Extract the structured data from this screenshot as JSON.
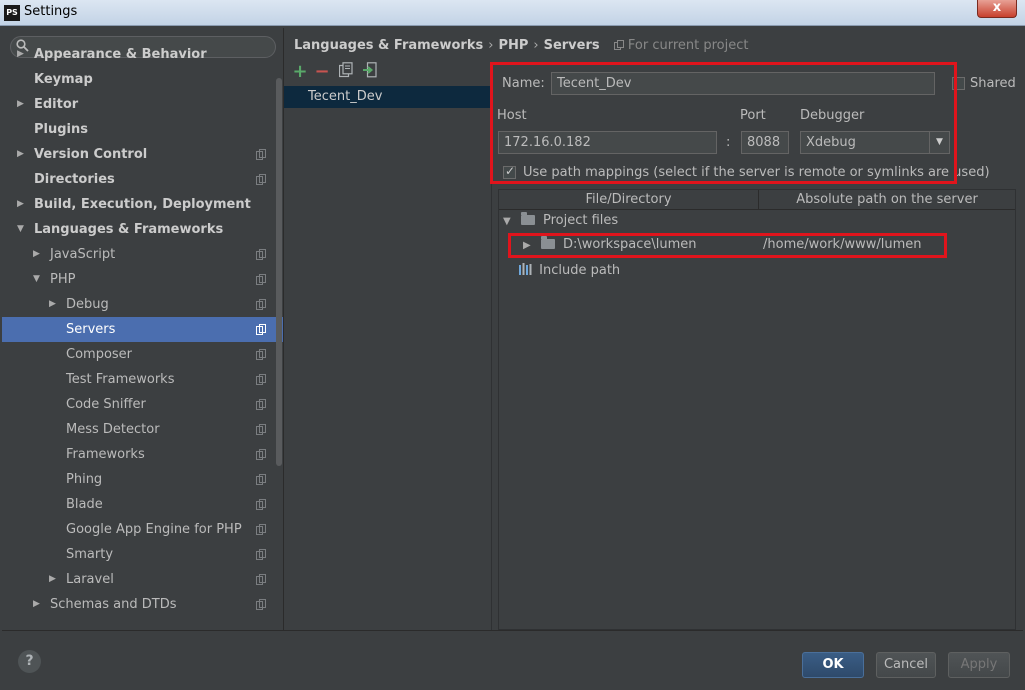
{
  "window": {
    "title": "Settings",
    "app_icon": "PS",
    "close_glyph": "x"
  },
  "sidebar": {
    "search_placeholder": "",
    "items": [
      {
        "label": "Appearance & Behavior",
        "level": 0,
        "arrow": "collapsed",
        "bold": true,
        "copy_icon": false
      },
      {
        "label": "Keymap",
        "level": 0,
        "arrow": "none",
        "bold": true,
        "copy_icon": false
      },
      {
        "label": "Editor",
        "level": 0,
        "arrow": "collapsed",
        "bold": true,
        "copy_icon": false
      },
      {
        "label": "Plugins",
        "level": 0,
        "arrow": "none",
        "bold": true,
        "copy_icon": false
      },
      {
        "label": "Version Control",
        "level": 0,
        "arrow": "collapsed",
        "bold": true,
        "copy_icon": true
      },
      {
        "label": "Directories",
        "level": 0,
        "arrow": "none",
        "bold": true,
        "copy_icon": true
      },
      {
        "label": "Build, Execution, Deployment",
        "level": 0,
        "arrow": "collapsed",
        "bold": true,
        "copy_icon": false
      },
      {
        "label": "Languages & Frameworks",
        "level": 0,
        "arrow": "expanded",
        "bold": true,
        "copy_icon": false
      },
      {
        "label": "JavaScript",
        "level": 1,
        "arrow": "collapsed",
        "bold": false,
        "copy_icon": true
      },
      {
        "label": "PHP",
        "level": 1,
        "arrow": "expanded",
        "bold": false,
        "copy_icon": true
      },
      {
        "label": "Debug",
        "level": 2,
        "arrow": "collapsed",
        "bold": false,
        "copy_icon": true
      },
      {
        "label": "Servers",
        "level": 2,
        "arrow": "none",
        "bold": false,
        "copy_icon": true,
        "selected": true
      },
      {
        "label": "Composer",
        "level": 2,
        "arrow": "none",
        "bold": false,
        "copy_icon": true
      },
      {
        "label": "Test Frameworks",
        "level": 2,
        "arrow": "none",
        "bold": false,
        "copy_icon": true
      },
      {
        "label": "Code Sniffer",
        "level": 2,
        "arrow": "none",
        "bold": false,
        "copy_icon": true
      },
      {
        "label": "Mess Detector",
        "level": 2,
        "arrow": "none",
        "bold": false,
        "copy_icon": true
      },
      {
        "label": "Frameworks",
        "level": 2,
        "arrow": "none",
        "bold": false,
        "copy_icon": true
      },
      {
        "label": "Phing",
        "level": 2,
        "arrow": "none",
        "bold": false,
        "copy_icon": true
      },
      {
        "label": "Blade",
        "level": 2,
        "arrow": "none",
        "bold": false,
        "copy_icon": true
      },
      {
        "label": "Google App Engine for PHP",
        "level": 2,
        "arrow": "none",
        "bold": false,
        "copy_icon": true
      },
      {
        "label": "Smarty",
        "level": 2,
        "arrow": "none",
        "bold": false,
        "copy_icon": true
      },
      {
        "label": "Laravel",
        "level": 2,
        "arrow": "collapsed",
        "bold": false,
        "copy_icon": true
      },
      {
        "label": "Schemas and DTDs",
        "level": 1,
        "arrow": "collapsed",
        "bold": false,
        "copy_icon": true
      }
    ]
  },
  "breadcrumb": {
    "items": [
      "Languages & Frameworks",
      "PHP",
      "Servers"
    ],
    "separator": "›",
    "scope": "For current project"
  },
  "toolbar": {
    "add": "+",
    "remove": "−"
  },
  "servers": {
    "items": [
      "Tecent_Dev"
    ]
  },
  "form": {
    "name_label": "Name:",
    "name_value": "Tecent_Dev",
    "shared_label": "Shared",
    "host_label": "Host",
    "host_value": "172.16.0.182",
    "colon": ":",
    "port_label": "Port",
    "port_value": "8088",
    "debugger_label": "Debugger",
    "debugger_value": "Xdebug",
    "path_mappings_label": "Use path mappings (select if the server is remote or symlinks are used)"
  },
  "mappings": {
    "col_file": "File/Directory",
    "col_server": "Absolute path on the server",
    "project_files": "Project files",
    "local_path": "D:\\workspace\\lumen",
    "server_path": "/home/work/www/lumen",
    "include_path": "Include path"
  },
  "footer": {
    "help": "?",
    "ok": "OK",
    "cancel": "Cancel",
    "apply": "Apply"
  },
  "colors": {
    "selection": "#4b6eaf",
    "highlight_box": "#e0141c",
    "add_green": "#59a869",
    "remove_red": "#c75450"
  }
}
